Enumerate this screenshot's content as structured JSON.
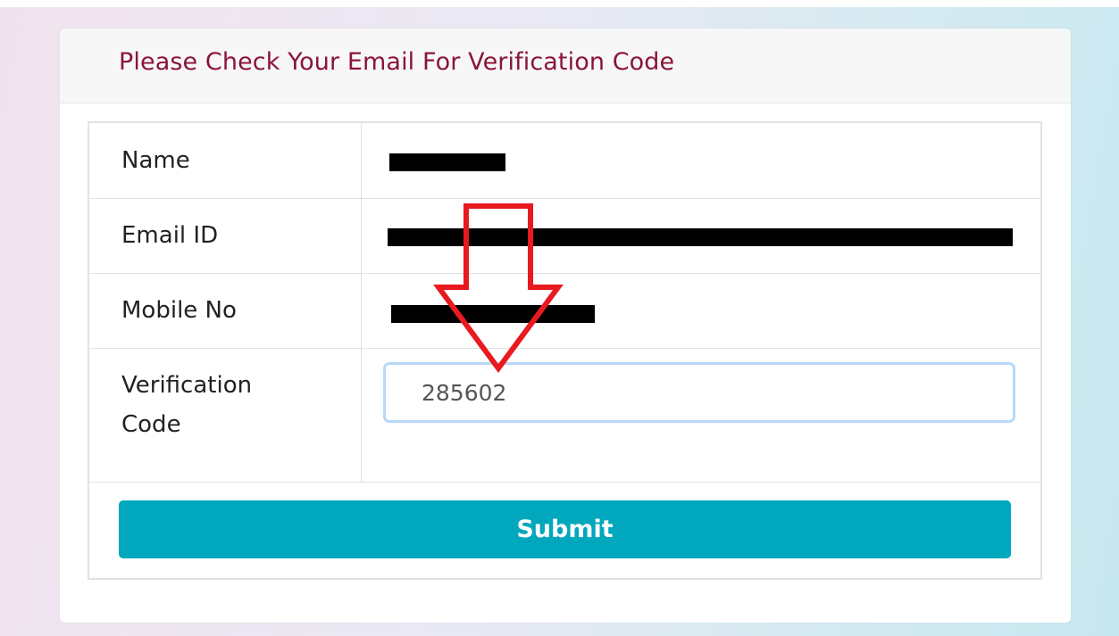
{
  "form": {
    "title": "Please Check Your Email For Verification Code",
    "fields": {
      "name_label": "Name",
      "email_label": "Email ID",
      "mobile_label": "Mobile No",
      "verification_label_line1": "Verification",
      "verification_label_line2": "Code"
    },
    "verification_code_value": "285602",
    "submit_label": "Submit"
  },
  "colors": {
    "title": "#8a1538",
    "submit_button": "#01a7bd",
    "input_focus_border": "#b8d9f7",
    "annotation_arrow": "#e8191f",
    "redaction": "#000000"
  }
}
